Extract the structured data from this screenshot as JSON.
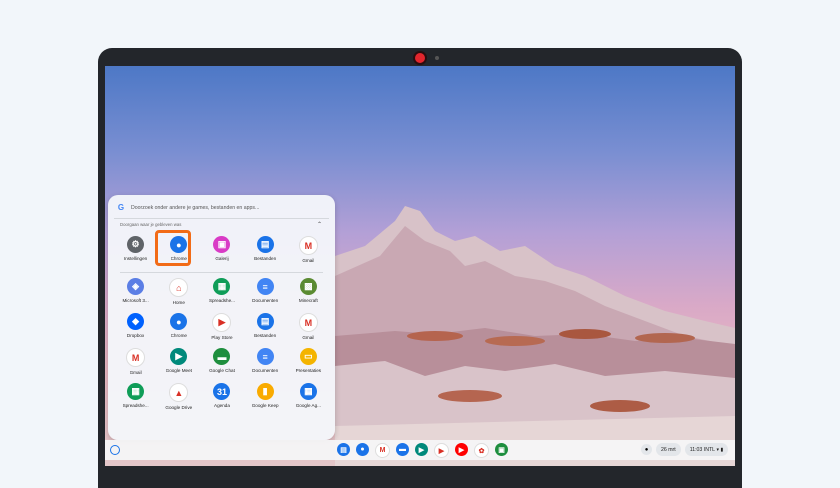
{
  "launcher": {
    "search_placeholder": "Doorzoek onder andere je games, bestanden en apps...",
    "continue_header": "Doorgaan waar je gebleven was",
    "continue_apps": [
      {
        "label": "Instellingen",
        "icon": "settings-icon",
        "color": "#5f6368",
        "glyph": "⚙"
      },
      {
        "label": "Chrome",
        "icon": "chrome-icon",
        "color": "#1a73e8",
        "glyph": "●"
      },
      {
        "label": "Galerij",
        "icon": "gallery-icon",
        "color": "#d93bc6",
        "glyph": "▣"
      },
      {
        "label": "Bestanden",
        "icon": "files-icon",
        "color": "#1a73e8",
        "glyph": "▤"
      },
      {
        "label": "Gmail",
        "icon": "gmail-icon",
        "color": "#ffffff",
        "glyph": "M"
      }
    ],
    "apps_rows": [
      [
        {
          "label": "Microsoft 3...",
          "icon": "microsoft-365-icon",
          "color": "#5b7ee5",
          "glyph": "◈"
        },
        {
          "label": "Home",
          "icon": "home-icon",
          "color": "#ffffff",
          "glyph": "⌂"
        },
        {
          "label": "Spreadshe...",
          "icon": "sheets-icon",
          "color": "#0f9d58",
          "glyph": "▦"
        },
        {
          "label": "Documenten",
          "icon": "docs-icon",
          "color": "#4285f4",
          "glyph": "≡"
        },
        {
          "label": "Minecraft",
          "icon": "minecraft-icon",
          "color": "#5b8b32",
          "glyph": "▩"
        }
      ],
      [
        {
          "label": "Dropbox",
          "icon": "dropbox-icon",
          "color": "#0061fe",
          "glyph": "◆"
        },
        {
          "label": "Chrome",
          "icon": "chrome-icon",
          "color": "#1a73e8",
          "glyph": "●"
        },
        {
          "label": "Play Store",
          "icon": "play-store-icon",
          "color": "#ffffff",
          "glyph": "▶"
        },
        {
          "label": "Bestanden",
          "icon": "files-icon",
          "color": "#1a73e8",
          "glyph": "▤"
        },
        {
          "label": "Gmail",
          "icon": "gmail-icon",
          "color": "#ffffff",
          "glyph": "M"
        }
      ],
      [
        {
          "label": "Gmail",
          "icon": "gmail-icon",
          "color": "#ffffff",
          "glyph": "M"
        },
        {
          "label": "Google Meet",
          "icon": "meet-icon",
          "color": "#00897b",
          "glyph": "▶"
        },
        {
          "label": "Google Chat",
          "icon": "chat-icon",
          "color": "#1e8e3e",
          "glyph": "▬"
        },
        {
          "label": "Documenten",
          "icon": "docs-icon",
          "color": "#4285f4",
          "glyph": "≡"
        },
        {
          "label": "Presentaties",
          "icon": "slides-icon",
          "color": "#f4b400",
          "glyph": "▭"
        }
      ],
      [
        {
          "label": "Spreadshe...",
          "icon": "sheets-icon",
          "color": "#0f9d58",
          "glyph": "▦"
        },
        {
          "label": "Google Drive",
          "icon": "drive-icon",
          "color": "#ffffff",
          "glyph": "▲"
        },
        {
          "label": "Agenda",
          "icon": "calendar-icon",
          "color": "#1a73e8",
          "glyph": "31"
        },
        {
          "label": "Google Keep",
          "icon": "keep-icon",
          "color": "#f9ab00",
          "glyph": "▮"
        },
        {
          "label": "Google Ag...",
          "icon": "google-app-icon",
          "color": "#1a73e8",
          "glyph": "▦"
        }
      ]
    ]
  },
  "shelf": {
    "pinned": [
      {
        "icon": "files-icon",
        "color": "#1a73e8",
        "glyph": "▤"
      },
      {
        "icon": "chrome-icon",
        "color": "#1a73e8",
        "glyph": "●"
      },
      {
        "icon": "gmail-icon",
        "color": "#ffffff",
        "glyph": "M"
      },
      {
        "icon": "messages-icon",
        "color": "#1a73e8",
        "glyph": "▬"
      },
      {
        "icon": "meet-icon",
        "color": "#00897b",
        "glyph": "▶"
      },
      {
        "icon": "play-store-icon",
        "color": "#ffffff",
        "glyph": "▶"
      },
      {
        "icon": "youtube-icon",
        "color": "#ff0000",
        "glyph": "▶"
      },
      {
        "icon": "photos-icon",
        "color": "#ffffff",
        "glyph": "✿"
      },
      {
        "icon": "classroom-icon",
        "color": "#1e8e3e",
        "glyph": "▣"
      }
    ],
    "date": "26 mrt",
    "time": "11:03",
    "keyboard": "INTL"
  },
  "accent_color": "#f26b17"
}
